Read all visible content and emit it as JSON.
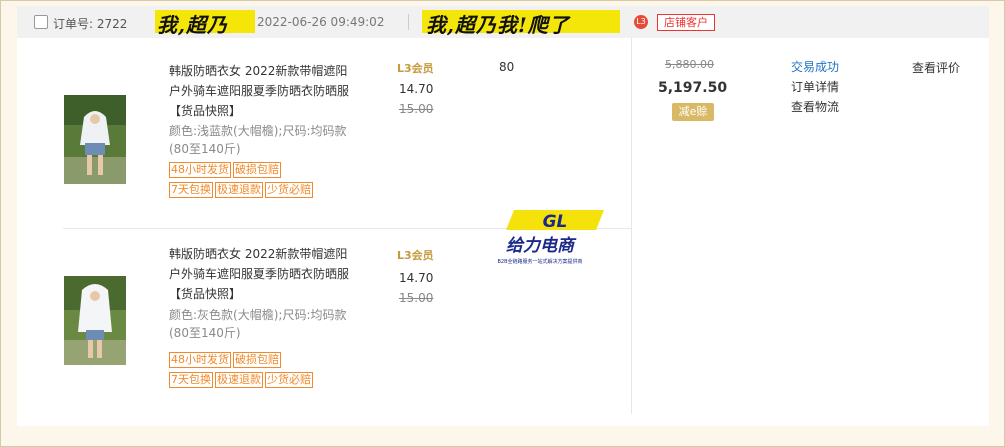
{
  "header": {
    "checkbox_checked": false,
    "order_label": "订单号: 2722",
    "scribble_left": "我,超乃",
    "time": "2022-06-26 09:49:02",
    "scribble_right": "我,超乃我!爬了",
    "shop_icon_text": "L3",
    "shop_tag": "店铺客户"
  },
  "items": [
    {
      "title": "韩版防晒衣女 2022新款带帽遮阳户外骑车遮阳服夏季防晒衣防晒服【货品快照】",
      "sku": "颜色:浅蓝款(大帽檐);尺码:均码款(80至140斤)",
      "tags_row1": [
        "48小时发货",
        "破损包赔"
      ],
      "tags_row2": [
        "7天包换",
        "极速退款",
        "少货必赔"
      ],
      "member": "L3会员",
      "price": "14.70",
      "old_price": "15.00",
      "qty": "80"
    },
    {
      "title": "韩版防晒衣女 2022新款带帽遮阳户外骑车遮阳服夏季防晒衣防晒服【货品快照】",
      "sku": "颜色:灰色款(大帽檐);尺码:均码款(80至140斤)",
      "tags_row1": [
        "48小时发货",
        "破损包赔"
      ],
      "tags_row2": [
        "7天包换",
        "极速退款",
        "少货必赔"
      ],
      "member": "L3会员",
      "price": "14.70",
      "old_price": "15.00",
      "qty": ""
    }
  ],
  "summary": {
    "original_total": "5,880.00",
    "total": "5,197.50",
    "discount_badge": "减e赊"
  },
  "status": {
    "state_link": "交易成功",
    "order_detail": "订单详情",
    "logistics": "查看物流",
    "review": "查看评价"
  },
  "watermark": {
    "brand": "给力电商",
    "logo_text": "GL",
    "tagline": "B2B全链路服务一站式解决方案提供商"
  },
  "colors": {
    "accent_orange": "#f08a2c",
    "link_blue": "#1e73c8",
    "highlight_yellow": "#f5e60a",
    "shop_red": "#e33333",
    "discount_gold": "#d9b866"
  }
}
